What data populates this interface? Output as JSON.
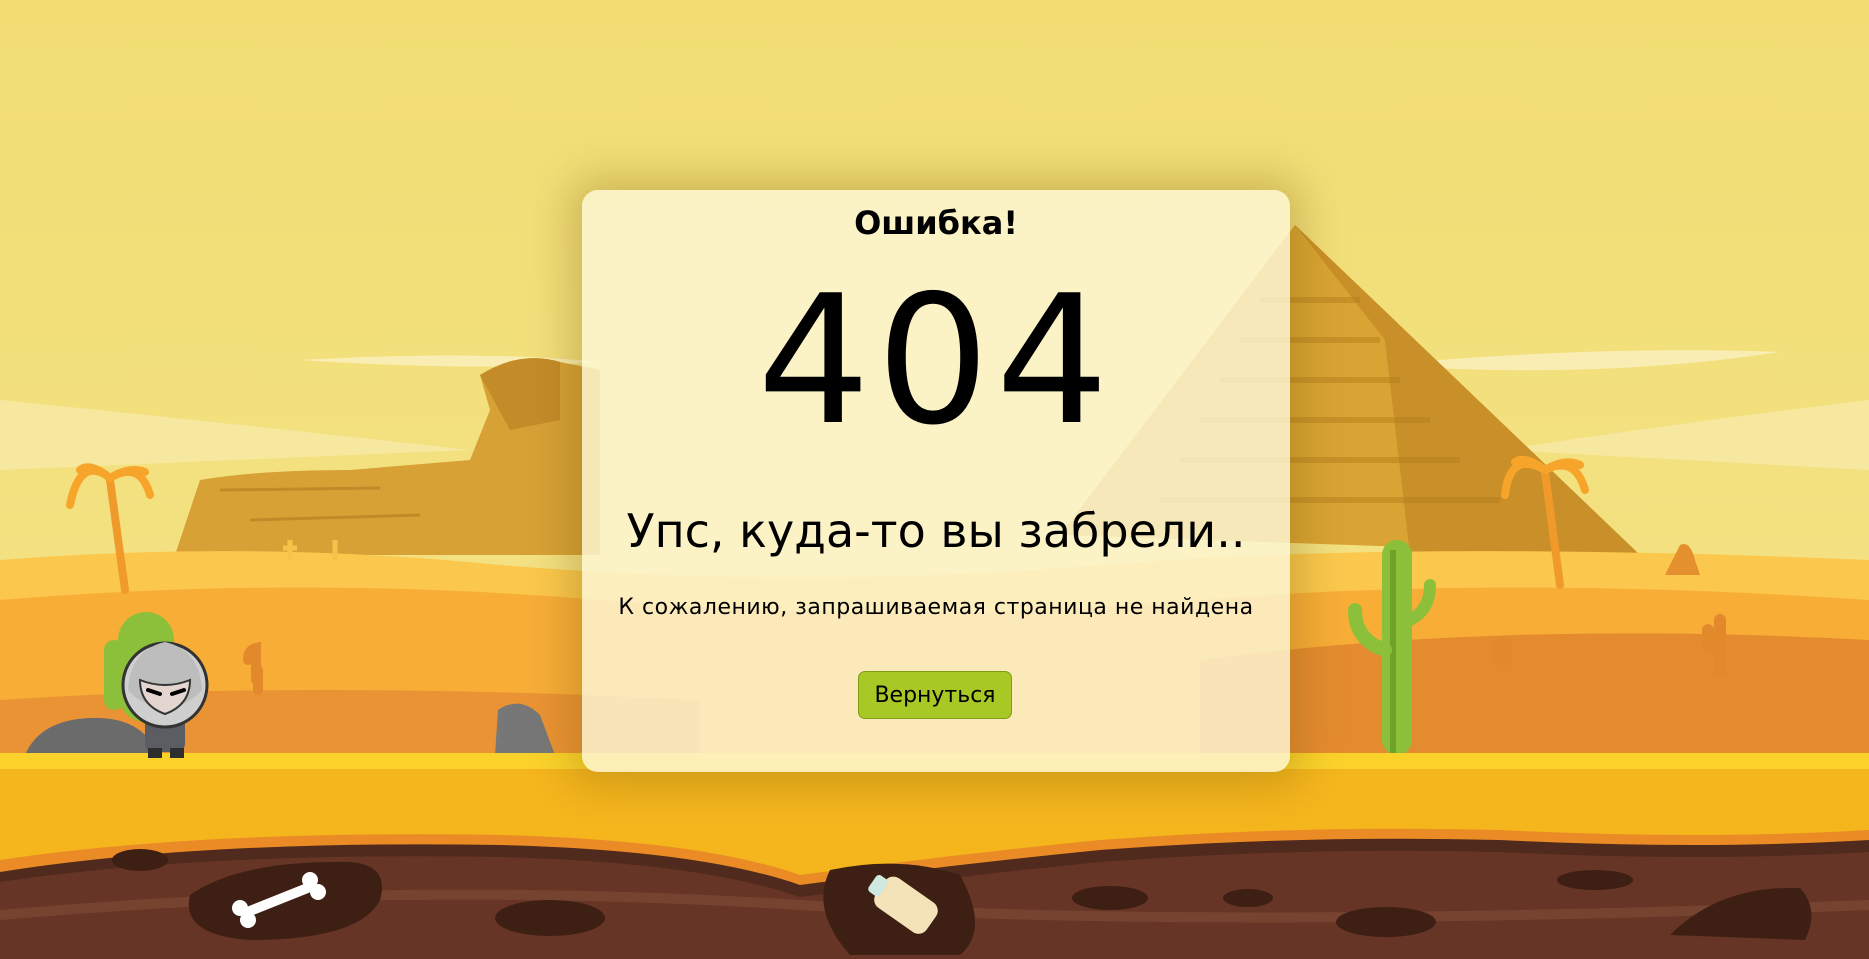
{
  "page": {
    "error_title": "Ошибка!",
    "code": "404",
    "heading": "Упс, куда-то вы забрели..",
    "message": "К сожалению, запрашиваемая страница не найдена",
    "back_button": "Вернуться"
  },
  "colors": {
    "sky": "#f1dd72",
    "dune": "#f8ad37",
    "ground": "#f4b51d",
    "soil": "#673525",
    "button": "#a8c826"
  },
  "icons": [
    "pyramid",
    "sphinx",
    "palm-tree",
    "cactus",
    "rock",
    "knight-character",
    "bone",
    "bottle"
  ]
}
